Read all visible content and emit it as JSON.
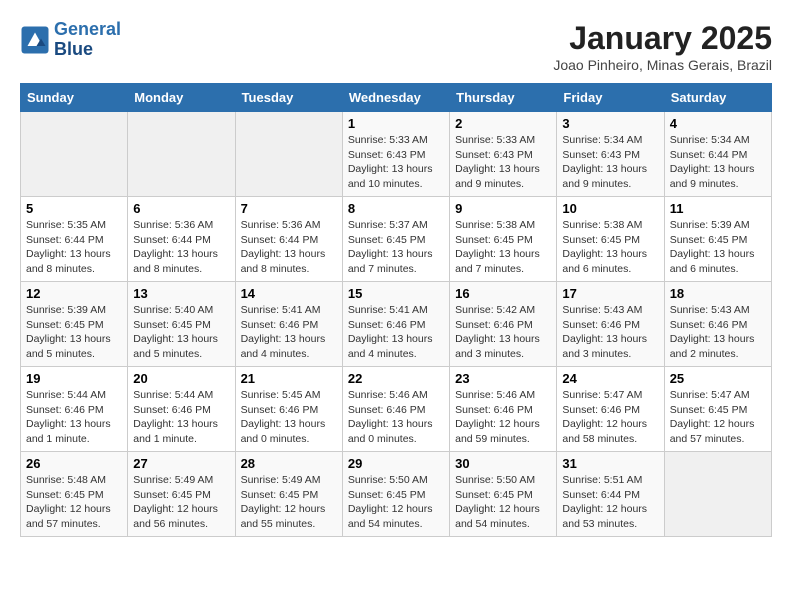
{
  "header": {
    "logo_line1": "General",
    "logo_line2": "Blue",
    "month": "January 2025",
    "location": "Joao Pinheiro, Minas Gerais, Brazil"
  },
  "weekdays": [
    "Sunday",
    "Monday",
    "Tuesday",
    "Wednesday",
    "Thursday",
    "Friday",
    "Saturday"
  ],
  "weeks": [
    [
      {
        "day": "",
        "info": ""
      },
      {
        "day": "",
        "info": ""
      },
      {
        "day": "",
        "info": ""
      },
      {
        "day": "1",
        "info": "Sunrise: 5:33 AM\nSunset: 6:43 PM\nDaylight: 13 hours\nand 10 minutes."
      },
      {
        "day": "2",
        "info": "Sunrise: 5:33 AM\nSunset: 6:43 PM\nDaylight: 13 hours\nand 9 minutes."
      },
      {
        "day": "3",
        "info": "Sunrise: 5:34 AM\nSunset: 6:43 PM\nDaylight: 13 hours\nand 9 minutes."
      },
      {
        "day": "4",
        "info": "Sunrise: 5:34 AM\nSunset: 6:44 PM\nDaylight: 13 hours\nand 9 minutes."
      }
    ],
    [
      {
        "day": "5",
        "info": "Sunrise: 5:35 AM\nSunset: 6:44 PM\nDaylight: 13 hours\nand 8 minutes."
      },
      {
        "day": "6",
        "info": "Sunrise: 5:36 AM\nSunset: 6:44 PM\nDaylight: 13 hours\nand 8 minutes."
      },
      {
        "day": "7",
        "info": "Sunrise: 5:36 AM\nSunset: 6:44 PM\nDaylight: 13 hours\nand 8 minutes."
      },
      {
        "day": "8",
        "info": "Sunrise: 5:37 AM\nSunset: 6:45 PM\nDaylight: 13 hours\nand 7 minutes."
      },
      {
        "day": "9",
        "info": "Sunrise: 5:38 AM\nSunset: 6:45 PM\nDaylight: 13 hours\nand 7 minutes."
      },
      {
        "day": "10",
        "info": "Sunrise: 5:38 AM\nSunset: 6:45 PM\nDaylight: 13 hours\nand 6 minutes."
      },
      {
        "day": "11",
        "info": "Sunrise: 5:39 AM\nSunset: 6:45 PM\nDaylight: 13 hours\nand 6 minutes."
      }
    ],
    [
      {
        "day": "12",
        "info": "Sunrise: 5:39 AM\nSunset: 6:45 PM\nDaylight: 13 hours\nand 5 minutes."
      },
      {
        "day": "13",
        "info": "Sunrise: 5:40 AM\nSunset: 6:45 PM\nDaylight: 13 hours\nand 5 minutes."
      },
      {
        "day": "14",
        "info": "Sunrise: 5:41 AM\nSunset: 6:46 PM\nDaylight: 13 hours\nand 4 minutes."
      },
      {
        "day": "15",
        "info": "Sunrise: 5:41 AM\nSunset: 6:46 PM\nDaylight: 13 hours\nand 4 minutes."
      },
      {
        "day": "16",
        "info": "Sunrise: 5:42 AM\nSunset: 6:46 PM\nDaylight: 13 hours\nand 3 minutes."
      },
      {
        "day": "17",
        "info": "Sunrise: 5:43 AM\nSunset: 6:46 PM\nDaylight: 13 hours\nand 3 minutes."
      },
      {
        "day": "18",
        "info": "Sunrise: 5:43 AM\nSunset: 6:46 PM\nDaylight: 13 hours\nand 2 minutes."
      }
    ],
    [
      {
        "day": "19",
        "info": "Sunrise: 5:44 AM\nSunset: 6:46 PM\nDaylight: 13 hours\nand 1 minute."
      },
      {
        "day": "20",
        "info": "Sunrise: 5:44 AM\nSunset: 6:46 PM\nDaylight: 13 hours\nand 1 minute."
      },
      {
        "day": "21",
        "info": "Sunrise: 5:45 AM\nSunset: 6:46 PM\nDaylight: 13 hours\nand 0 minutes."
      },
      {
        "day": "22",
        "info": "Sunrise: 5:46 AM\nSunset: 6:46 PM\nDaylight: 13 hours\nand 0 minutes."
      },
      {
        "day": "23",
        "info": "Sunrise: 5:46 AM\nSunset: 6:46 PM\nDaylight: 12 hours\nand 59 minutes."
      },
      {
        "day": "24",
        "info": "Sunrise: 5:47 AM\nSunset: 6:46 PM\nDaylight: 12 hours\nand 58 minutes."
      },
      {
        "day": "25",
        "info": "Sunrise: 5:47 AM\nSunset: 6:45 PM\nDaylight: 12 hours\nand 57 minutes."
      }
    ],
    [
      {
        "day": "26",
        "info": "Sunrise: 5:48 AM\nSunset: 6:45 PM\nDaylight: 12 hours\nand 57 minutes."
      },
      {
        "day": "27",
        "info": "Sunrise: 5:49 AM\nSunset: 6:45 PM\nDaylight: 12 hours\nand 56 minutes."
      },
      {
        "day": "28",
        "info": "Sunrise: 5:49 AM\nSunset: 6:45 PM\nDaylight: 12 hours\nand 55 minutes."
      },
      {
        "day": "29",
        "info": "Sunrise: 5:50 AM\nSunset: 6:45 PM\nDaylight: 12 hours\nand 54 minutes."
      },
      {
        "day": "30",
        "info": "Sunrise: 5:50 AM\nSunset: 6:45 PM\nDaylight: 12 hours\nand 54 minutes."
      },
      {
        "day": "31",
        "info": "Sunrise: 5:51 AM\nSunset: 6:44 PM\nDaylight: 12 hours\nand 53 minutes."
      },
      {
        "day": "",
        "info": ""
      }
    ]
  ]
}
